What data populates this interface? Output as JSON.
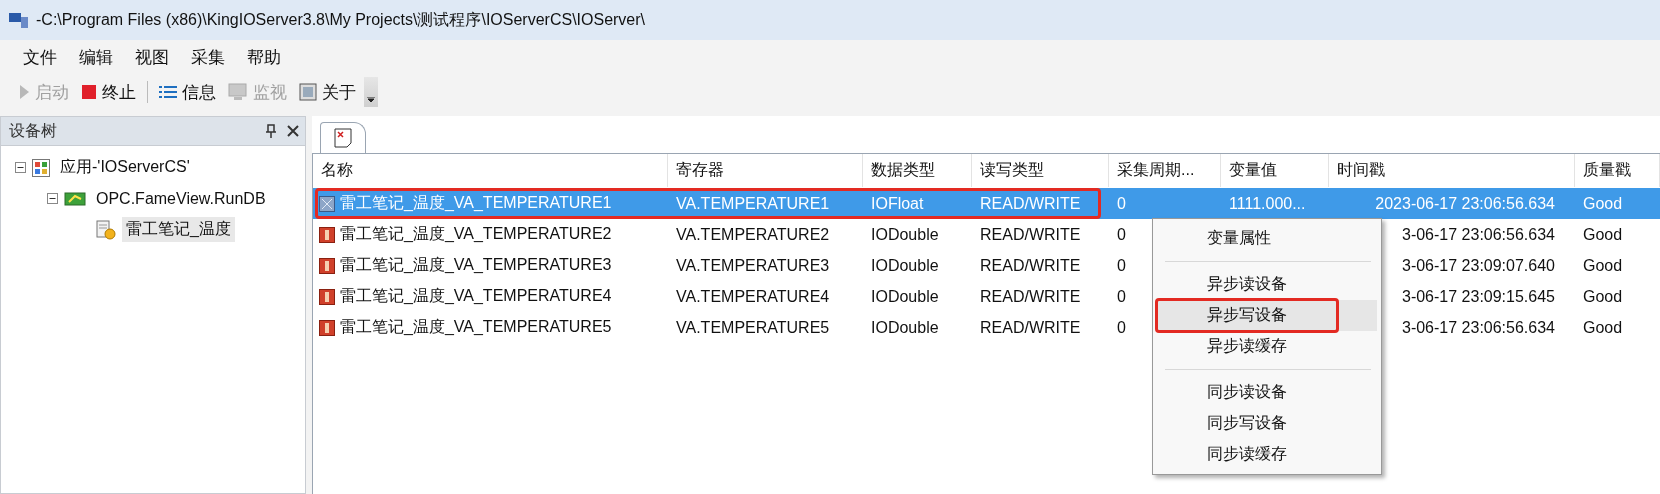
{
  "window": {
    "title": "-C:\\Program Files (x86)\\KingIOServer3.8\\My Projects\\测试程序\\IOServerCS\\IOServer\\"
  },
  "menu_bar": [
    "文件",
    "编辑",
    "视图",
    "采集",
    "帮助"
  ],
  "toolbar": [
    {
      "kind": "play",
      "label": "启动",
      "disabled": true
    },
    {
      "kind": "stop",
      "label": "终止",
      "disabled": false
    },
    {
      "kind": "separator"
    },
    {
      "kind": "list",
      "label": "信息",
      "disabled": false
    },
    {
      "kind": "monitor",
      "label": "监视",
      "disabled": true
    },
    {
      "kind": "about",
      "label": "关于",
      "disabled": false
    },
    {
      "kind": "overflow"
    }
  ],
  "device_tree": {
    "title": "设备树",
    "items": [
      {
        "kind": "app",
        "label": "应用-'IOServerCS'",
        "expanded": true,
        "selected": false,
        "children": [
          {
            "kind": "opc",
            "label": "OPC.FameView.RunDB",
            "expanded": true,
            "selected": false,
            "children": [
              {
                "kind": "device",
                "label": "雷工笔记_温度",
                "selected": true
              }
            ]
          }
        ]
      }
    ]
  },
  "table": {
    "columns": [
      "名称",
      "寄存器",
      "数据类型",
      "读写类型",
      "采集周期...",
      "变量值",
      "时间戳",
      "质量戳"
    ],
    "rows": [
      {
        "kind": "float",
        "name": "雷工笔记_温度_VA_TEMPERATURE1",
        "register": "VA.TEMPERATURE1",
        "data_type": "IOFloat",
        "rw_type": "READ/WRITE",
        "period": "0",
        "value": "1111.000...",
        "time": "2023-06-17 23:06:56.634",
        "quality": "Good",
        "selected": true,
        "annotated": true
      },
      {
        "kind": "double",
        "name": "雷工笔记_温度_VA_TEMPERATURE2",
        "register": "VA.TEMPERATURE2",
        "data_type": "IODouble",
        "rw_type": "READ/WRITE",
        "period": "0",
        "time": "3-06-17 23:06:56.634",
        "quality": "Good",
        "selected": false,
        "annotated": false
      },
      {
        "kind": "double",
        "name": "雷工笔记_温度_VA_TEMPERATURE3",
        "register": "VA.TEMPERATURE3",
        "data_type": "IODouble",
        "rw_type": "READ/WRITE",
        "period": "0",
        "time": "3-06-17 23:09:07.640",
        "quality": "Good",
        "selected": false,
        "annotated": false
      },
      {
        "kind": "double",
        "name": "雷工笔记_温度_VA_TEMPERATURE4",
        "register": "VA.TEMPERATURE4",
        "data_type": "IODouble",
        "rw_type": "READ/WRITE",
        "period": "0",
        "time": "3-06-17 23:09:15.645",
        "quality": "Good",
        "selected": false,
        "annotated": false
      },
      {
        "kind": "double",
        "name": "雷工笔记_温度_VA_TEMPERATURE5",
        "register": "VA.TEMPERATURE5",
        "data_type": "IODouble",
        "rw_type": "READ/WRITE",
        "period": "0",
        "time": "3-06-17 23:06:56.634",
        "quality": "Good",
        "selected": false,
        "annotated": false
      }
    ]
  },
  "context_menu": [
    {
      "kind": "item",
      "label": "变量属性",
      "selected": false,
      "annotated": false
    },
    {
      "kind": "separator"
    },
    {
      "kind": "item",
      "label": "异步读设备",
      "selected": false,
      "annotated": false
    },
    {
      "kind": "item",
      "label": "异步写设备",
      "selected": true,
      "annotated": true
    },
    {
      "kind": "item",
      "label": "异步读缓存",
      "selected": false,
      "annotated": false
    },
    {
      "kind": "separator"
    },
    {
      "kind": "item",
      "label": "同步读设备",
      "selected": false,
      "annotated": false
    },
    {
      "kind": "item",
      "label": "同步写设备",
      "selected": false,
      "annotated": false
    },
    {
      "kind": "item",
      "label": "同步读缓存",
      "selected": false,
      "annotated": false
    }
  ]
}
